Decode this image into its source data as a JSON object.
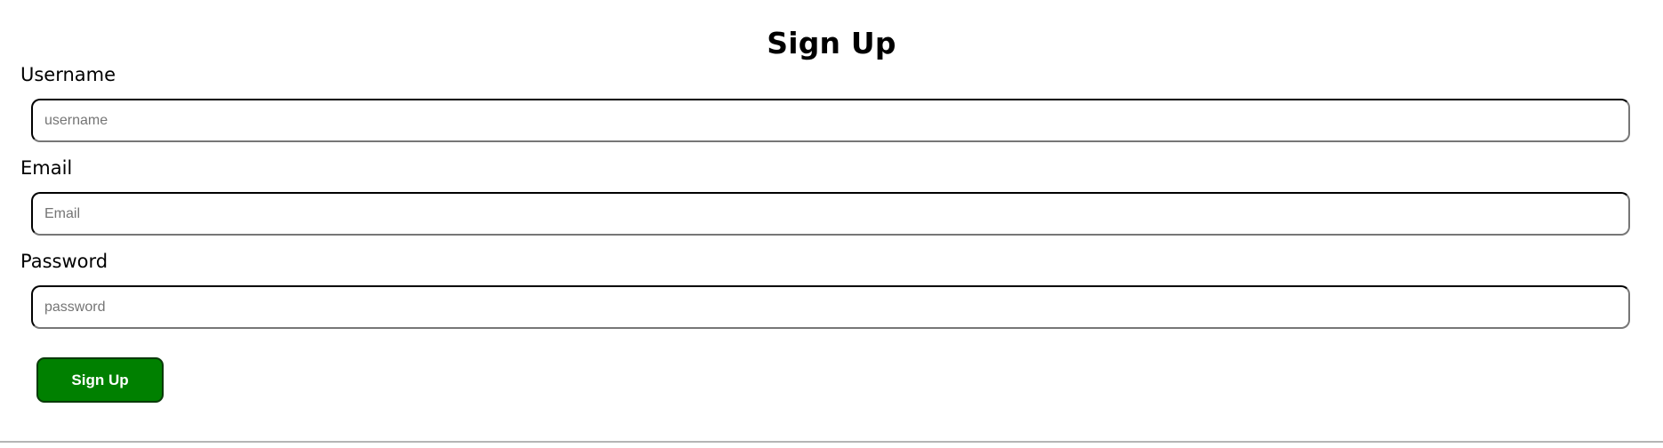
{
  "page": {
    "title": "Sign Up"
  },
  "form": {
    "username": {
      "label": "Username",
      "placeholder": "username",
      "value": ""
    },
    "email": {
      "label": "Email",
      "placeholder": "Email",
      "value": ""
    },
    "password": {
      "label": "Password",
      "placeholder": "password",
      "value": ""
    },
    "submit_label": "Sign Up"
  },
  "colors": {
    "button_background": "#008000",
    "button_text": "#ffffff",
    "field_border": "#000000",
    "divider": "#b5b5b5"
  }
}
